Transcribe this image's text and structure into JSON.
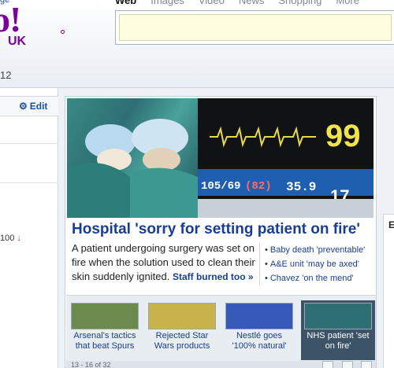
{
  "brand": {
    "logo_text": "oo!",
    "region": "UK",
    "corner_link": "ge"
  },
  "search": {
    "tabs": [
      "Web",
      "Images",
      "Video",
      "News",
      "Shopping",
      "More"
    ],
    "active_tab": "Web",
    "query": ""
  },
  "header_date_fragment": "12",
  "left_panel": {
    "edit_label": "Edit",
    "index_value": "100"
  },
  "feature": {
    "headline": "Hospital 'sorry for setting patient on fire'",
    "summary": "A patient undergoing surgery was set on fire when the solution used to clean their skin suddenly ignited.",
    "more_link": "Staff burned too »",
    "related": [
      "Baby death 'preventable'",
      "A&E unit 'may be axed'",
      "Chavez 'on the mend'"
    ],
    "monitor": {
      "heart_rate": "99",
      "bp": "105/69",
      "map": "(82)",
      "temp": "35.9",
      "rr": "17"
    }
  },
  "thumbnails": [
    {
      "caption": "Arsenal's tactics that beat Spurs",
      "selected": false,
      "color": "#6c8a4e"
    },
    {
      "caption": "Rejected Star Wars products",
      "selected": false,
      "color": "#c9b34c"
    },
    {
      "caption": "Nestlé goes '100% natural'",
      "selected": false,
      "color": "#3459b8"
    },
    {
      "caption": "NHS patient 'set on fire'",
      "selected": true,
      "color": "#2e6f73"
    }
  ],
  "pager": {
    "text": "13 - 16 of 32"
  },
  "right_col_letter": "E",
  "colors": {
    "brand": "#7b0099",
    "link": "#1a3d94",
    "index_down": "#d2380f"
  }
}
